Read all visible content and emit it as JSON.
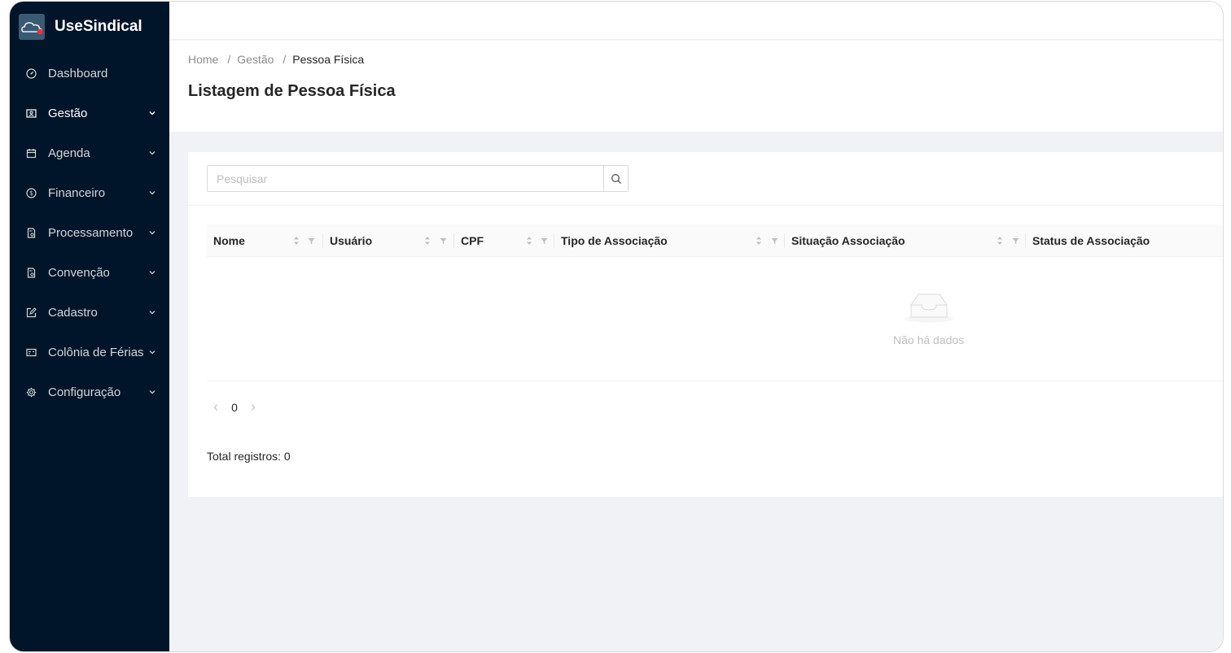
{
  "app": {
    "name": "UseSindical"
  },
  "sidebar": {
    "items": [
      {
        "label": "Dashboard",
        "icon": "dashboard-icon",
        "expandable": false
      },
      {
        "label": "Gestão",
        "icon": "gestao-icon",
        "expandable": true,
        "active": true
      },
      {
        "label": "Agenda",
        "icon": "calendar-icon",
        "expandable": true
      },
      {
        "label": "Financeiro",
        "icon": "dollar-icon",
        "expandable": true
      },
      {
        "label": "Processamento",
        "icon": "document-icon",
        "expandable": true
      },
      {
        "label": "Convenção",
        "icon": "document-icon",
        "expandable": true
      },
      {
        "label": "Cadastro",
        "icon": "edit-icon",
        "expandable": true
      },
      {
        "label": "Colônia de Férias",
        "icon": "card-icon",
        "expandable": true
      },
      {
        "label": "Configuração",
        "icon": "gear-icon",
        "expandable": true
      }
    ]
  },
  "breadcrumb": {
    "home": "Home",
    "section": "Gestão",
    "current": "Pessoa Física",
    "separator": "/"
  },
  "page": {
    "title": "Listagem de Pessoa Física"
  },
  "search": {
    "placeholder": "Pesquisar",
    "value": ""
  },
  "table": {
    "columns": [
      {
        "label": "Nome"
      },
      {
        "label": "Usuário"
      },
      {
        "label": "CPF"
      },
      {
        "label": "Tipo de Associação"
      },
      {
        "label": "Situação Associação"
      },
      {
        "label": "Status de Associação"
      }
    ],
    "rows": [],
    "empty_text": "Não há dados"
  },
  "pagination": {
    "current_page": "0"
  },
  "total": {
    "label": "Total registros: 0"
  },
  "colors": {
    "sidebar_bg": "#001529",
    "content_bg": "#f0f2f5"
  }
}
